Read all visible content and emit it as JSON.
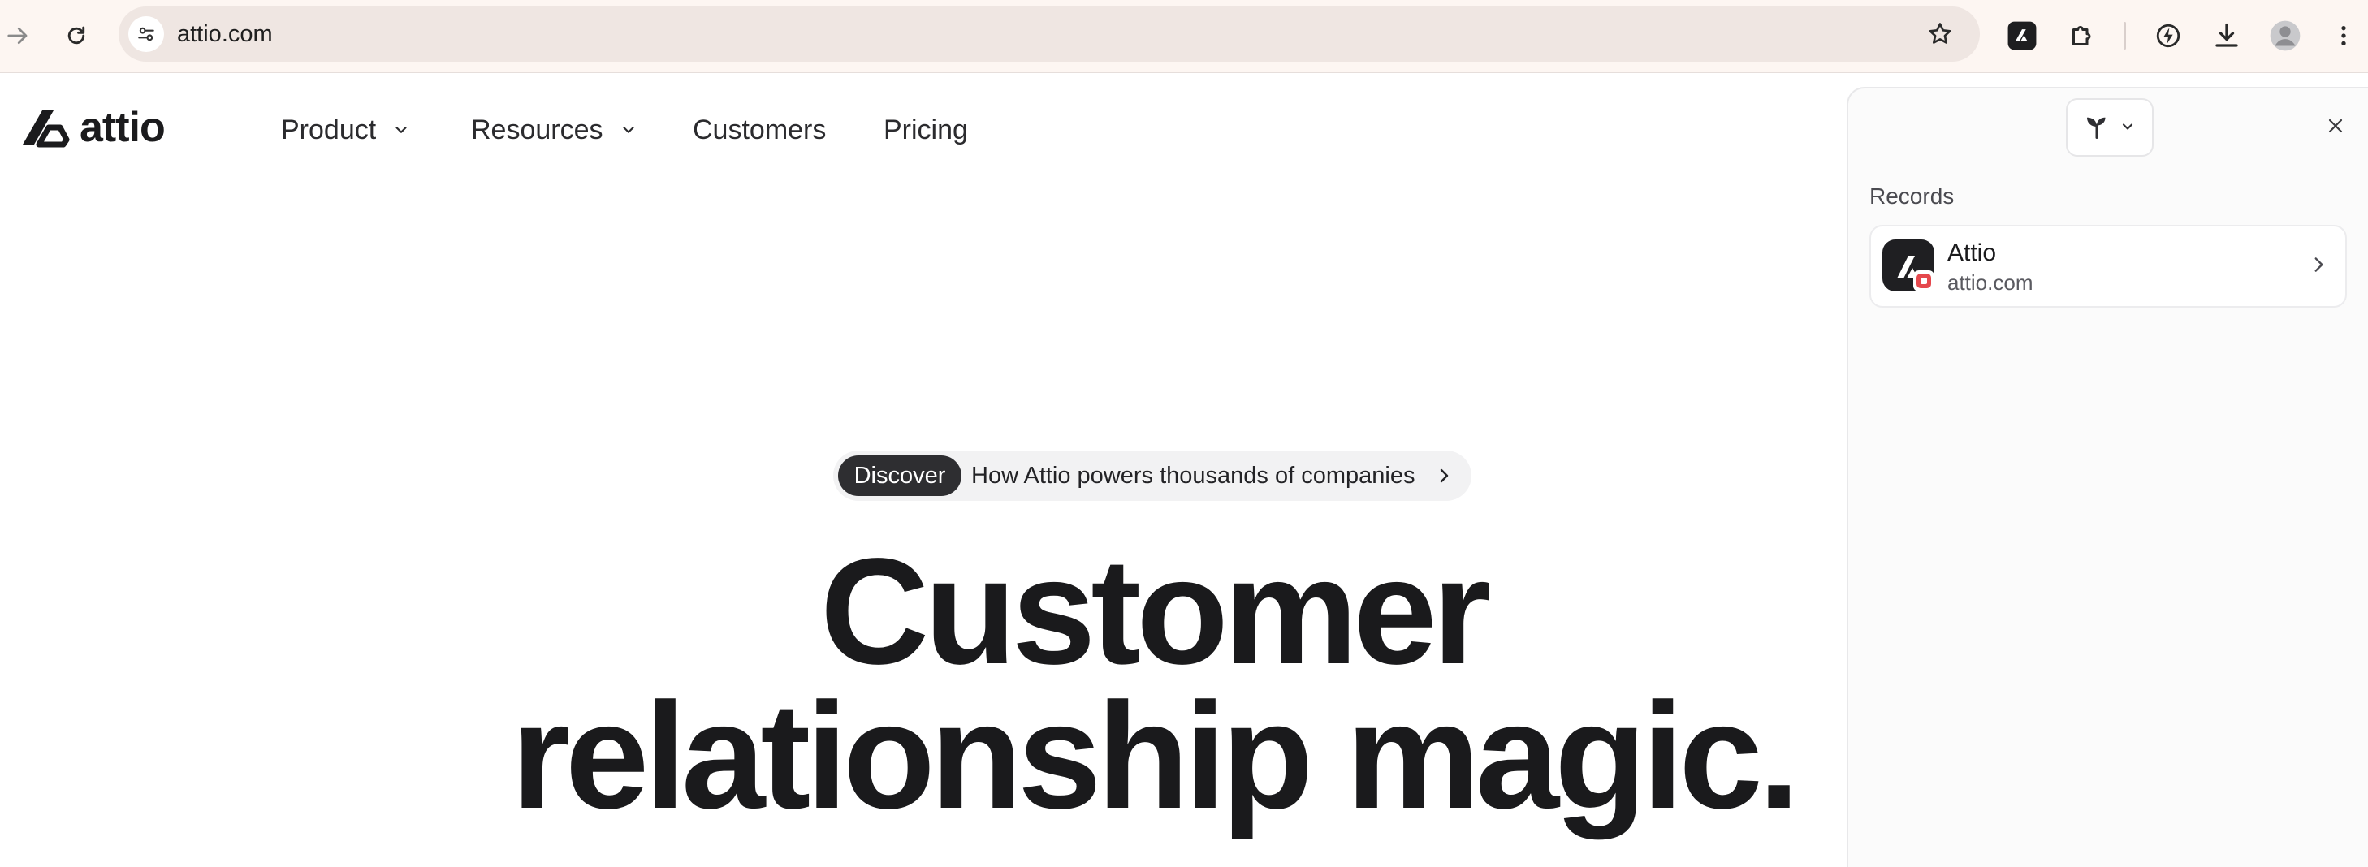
{
  "browser": {
    "url": "attio.com"
  },
  "site": {
    "logo_text": "attio",
    "nav": [
      {
        "label": "Product"
      },
      {
        "label": "Resources"
      },
      {
        "label": "Customers"
      },
      {
        "label": "Pricing"
      }
    ],
    "announcement": {
      "tag": "Discover",
      "text": "How Attio powers thousands of companies"
    },
    "headline": {
      "line1": "Customer",
      "line2": "relationship magic."
    }
  },
  "panel": {
    "section_label": "Records",
    "records": [
      {
        "name": "Attio",
        "domain": "attio.com"
      }
    ]
  },
  "colors": {
    "chrome_bg": "#fdf6f2",
    "omnibox_bg": "#efe6e2",
    "text_dark": "#1a1a1c",
    "pill_tag_bg": "#2e2e31",
    "badge_red": "#e5484d"
  },
  "icons": [
    "forward-icon",
    "reload-icon",
    "site-settings-icon",
    "bookmark-star-icon",
    "attio-extension-icon",
    "extensions-puzzle-icon",
    "performance-icon",
    "download-icon",
    "profile-avatar",
    "more-vert-icon",
    "chevron-down-icon",
    "chevron-right-icon",
    "sprout-icon",
    "close-icon"
  ]
}
